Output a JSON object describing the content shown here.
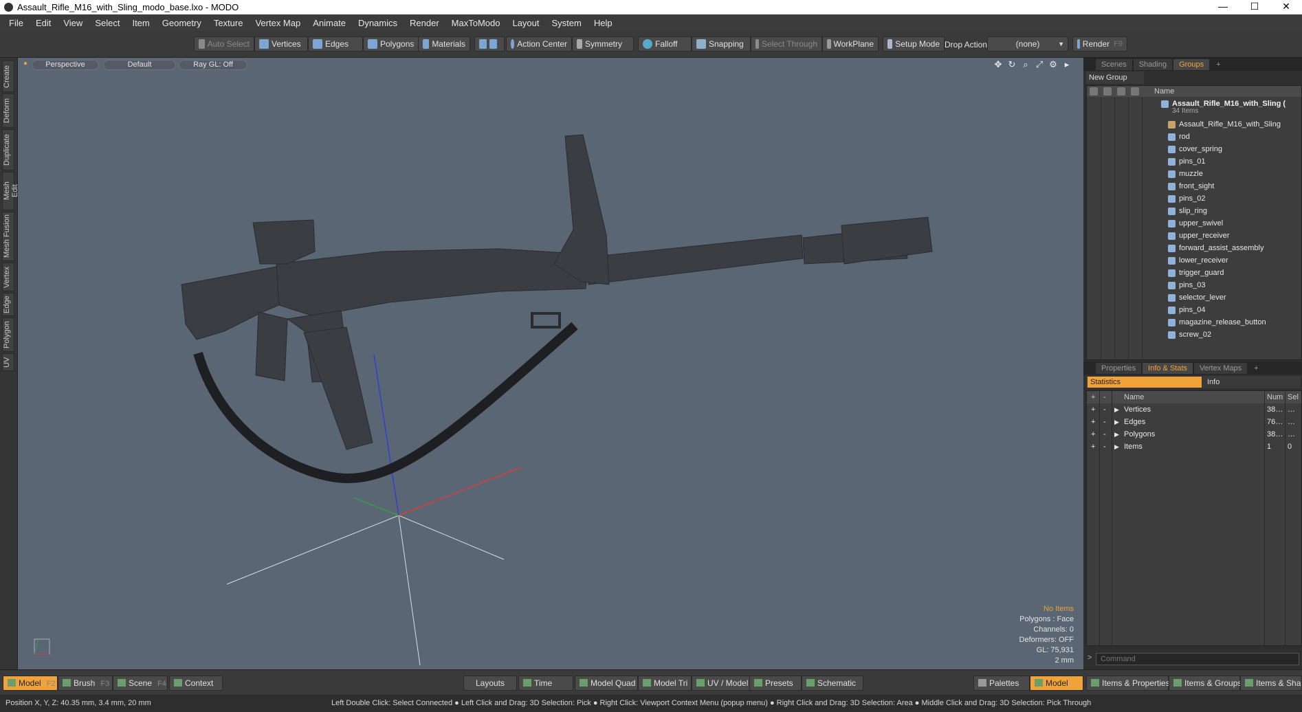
{
  "window": {
    "title": "Assault_Rifle_M16_with_Sling_modo_base.lxo - MODO",
    "minimize": "—",
    "maximize": "☐",
    "close": "✕"
  },
  "menu": [
    "File",
    "Edit",
    "View",
    "Select",
    "Item",
    "Geometry",
    "Texture",
    "Vertex Map",
    "Animate",
    "Dynamics",
    "Render",
    "MaxToModo",
    "Layout",
    "System",
    "Help"
  ],
  "toolbar": {
    "auto_select": "Auto Select",
    "vertices": "Vertices",
    "edges": "Edges",
    "polygons": "Polygons",
    "materials": "Materials",
    "action_center": "Action Center",
    "symmetry": "Symmetry",
    "falloff": "Falloff",
    "snapping": "Snapping",
    "select_through": "Select Through",
    "workplane": "WorkPlane",
    "setup_mode": "Setup Mode",
    "drop_action": "Drop Action",
    "drop_value": "(none)",
    "render": "Render",
    "render_key": "F9"
  },
  "left_tabs": [
    "Create",
    "Deform",
    "Duplicate",
    "Mesh Edit",
    "Mesh Fusion",
    "Vertex",
    "Edge",
    "Polygon",
    "UV"
  ],
  "viewport": {
    "view": "Perspective",
    "shading": "Default",
    "raygl": "Ray GL: Off",
    "info": {
      "items": "No Items",
      "polygons": "Polygons : Face",
      "channels": "Channels: 0",
      "deformers": "Deformers: OFF",
      "gl": "GL: 75,931",
      "unit": "2 mm"
    }
  },
  "groups_panel": {
    "tabs": [
      "Scenes",
      "Shading",
      "Groups"
    ],
    "active_tab": "Groups",
    "add": "+",
    "new_group": "New Group",
    "col_name": "Name",
    "root": "Assault_Rifle_M16_with_Sling (",
    "root_count": "34 Items",
    "items": [
      "Assault_Rifle_M16_with_Sling",
      "rod",
      "cover_spring",
      "pins_01",
      "muzzle",
      "front_sight",
      "pins_02",
      "slip_ring",
      "upper_swivel",
      "upper_receiver",
      "forward_assist_assembly",
      "lower_receiver",
      "trigger_guard",
      "pins_03",
      "selector_lever",
      "pins_04",
      "magazine_release_button",
      "screw_02"
    ]
  },
  "stats_panel": {
    "tabs": [
      "Properties",
      "Info & Stats",
      "Vertex Maps"
    ],
    "active_tab": "Info & Stats",
    "add": "+",
    "statistics": "Statistics",
    "info": "Info",
    "columns": {
      "name": "Name",
      "num": "Num",
      "sel": "Sel"
    },
    "rows": [
      {
        "name": "Vertices",
        "num": "38…",
        "sel": "…"
      },
      {
        "name": "Edges",
        "num": "76…",
        "sel": "…"
      },
      {
        "name": "Polygons",
        "num": "38…",
        "sel": "…"
      },
      {
        "name": "Items",
        "num": "1",
        "sel": "0"
      }
    ],
    "command_placeholder": "Command"
  },
  "bottom": {
    "model": "Model",
    "model_key": "F2",
    "brush": "Brush",
    "brush_key": "F3",
    "scene": "Scene",
    "scene_key": "F4",
    "context": "Context",
    "layouts": "Layouts",
    "time": "Time",
    "model_quad": "Model Quad",
    "model_tri": "Model Tri",
    "uv_model": "UV / Model",
    "presets": "Presets",
    "schematic": "Schematic",
    "palettes": "Palettes",
    "model_right": "Model",
    "items_properties": "Items & Properties",
    "items_groups": "Items & Groups",
    "items_shading": "Items & Shadi"
  },
  "status": {
    "position": "Position X, Y, Z:  40.35 mm, 3.4 mm, 20 mm",
    "hint": "Left Double Click: Select Connected ● Left Click and Drag: 3D Selection: Pick ● Right Click: Viewport Context Menu (popup menu) ● Right Click and Drag: 3D Selection: Area ● Middle Click and Drag: 3D Selection: Pick Through"
  },
  "colors": {
    "accent": "#f0a33a",
    "viewport_bg": "#5b6674"
  }
}
